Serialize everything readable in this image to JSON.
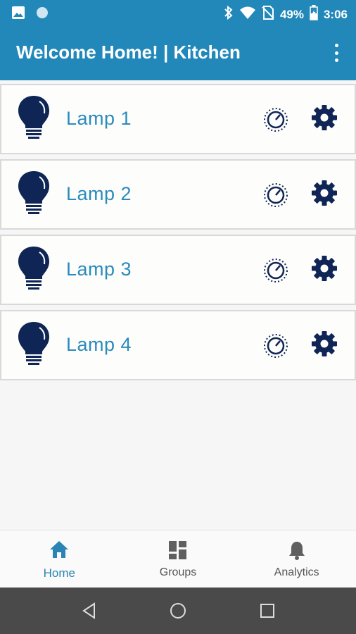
{
  "status_bar": {
    "battery_percent": "49%",
    "time": "3:06",
    "icons": [
      "image-icon",
      "circle-icon",
      "bluetooth-icon",
      "wifi-icon",
      "no-sim-icon",
      "battery-icon"
    ]
  },
  "app_bar": {
    "title": "Welcome Home! | Kitchen",
    "menu_icon": "more-vert-icon"
  },
  "lamps": [
    {
      "name": "Lamp 1",
      "icon": "lightbulb-icon",
      "dimmer_icon": "dimmer-dial-icon",
      "settings_icon": "gear-icon"
    },
    {
      "name": "Lamp 2",
      "icon": "lightbulb-icon",
      "dimmer_icon": "dimmer-dial-icon",
      "settings_icon": "gear-icon"
    },
    {
      "name": "Lamp 3",
      "icon": "lightbulb-icon",
      "dimmer_icon": "dimmer-dial-icon",
      "settings_icon": "gear-icon"
    },
    {
      "name": "Lamp 4",
      "icon": "lightbulb-icon",
      "dimmer_icon": "dimmer-dial-icon",
      "settings_icon": "gear-icon"
    }
  ],
  "bottom_nav": {
    "items": [
      {
        "label": "Home",
        "icon": "home-icon",
        "active": true
      },
      {
        "label": "Groups",
        "icon": "dashboard-icon",
        "active": false
      },
      {
        "label": "Analytics",
        "icon": "bell-icon",
        "active": false
      }
    ]
  },
  "system_nav": {
    "icons": [
      "back-icon",
      "home-circle-icon",
      "recents-icon"
    ]
  },
  "colors": {
    "primary": "#2188b9",
    "accent_text": "#2a8bbd",
    "icon_navy": "#0e2555",
    "system_bar": "#4a4a4a"
  }
}
